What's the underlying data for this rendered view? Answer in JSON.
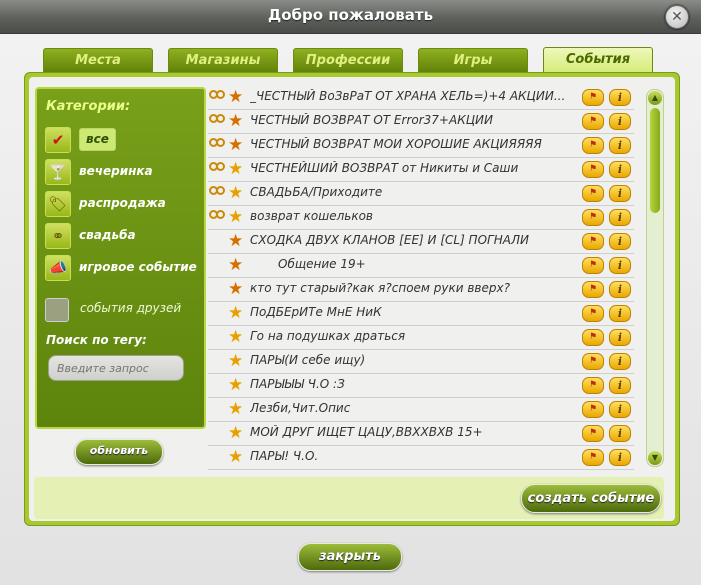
{
  "window": {
    "title": "Добро пожаловать",
    "close_glyph": "✕"
  },
  "tabs": [
    {
      "label": "Места",
      "active": false
    },
    {
      "label": "Магазины",
      "active": false
    },
    {
      "label": "Профессии",
      "active": false
    },
    {
      "label": "Игры",
      "active": false
    },
    {
      "label": "События",
      "active": true
    }
  ],
  "sidebar": {
    "heading": "Категории:",
    "categories": [
      {
        "label": "все",
        "icon": "check-icon",
        "glyph": "✔",
        "selected": true
      },
      {
        "label": "вечеринка",
        "icon": "cocktail-icon",
        "glyph": "🍸"
      },
      {
        "label": "распродажа",
        "icon": "price-tag-icon",
        "glyph": "🏷"
      },
      {
        "label": "свадьба",
        "icon": "rings-icon",
        "glyph": "⚭"
      },
      {
        "label": "игровое событие",
        "icon": "megaphone-icon",
        "glyph": "📣"
      }
    ],
    "friends_events": {
      "label": "события друзей",
      "checked": false
    },
    "tag_search": {
      "label": "Поиск по тегу:",
      "placeholder": "Введите запрос",
      "value": ""
    }
  },
  "refresh_button": "обновить",
  "events": [
    {
      "title": "_ЧЕСТНЫЙ ВоЗвРаТ ОТ ХРАНА ХЕЛЬ=)+4 АКЦИИ...",
      "rings": true,
      "dual": true
    },
    {
      "title": "ЧЕСТНЫЙ ВОЗВРАТ ОТ Error37+АКЦИИ",
      "rings": true,
      "dual": true
    },
    {
      "title": "ЧЕСТНЫЙ ВОЗВРАТ МОИ ХОРОШИЕ АКЦИЯЯЯЯ",
      "rings": true,
      "dual": true
    },
    {
      "title": "ЧЕСТНЕЙШИЙ ВОЗВРАТ от Никиты и Саши",
      "rings": true,
      "dual": false
    },
    {
      "title": "СВАДЬБА/Приходите",
      "rings": true,
      "dual": false
    },
    {
      "title": "возврат кошельков",
      "rings": true,
      "dual": false
    },
    {
      "title": "СХОДКА ДВУХ КЛАНОВ [EE] И [CL] ПОГНАЛИ",
      "rings": false,
      "dual": true
    },
    {
      "title": "Общение 19+",
      "rings": false,
      "dual": true,
      "indent": true
    },
    {
      "title": "кто тут старый?как я?споем руки вверх?",
      "rings": false,
      "dual": true
    },
    {
      "title": "ПоДБЕрИТе МнЕ НиК",
      "rings": false,
      "dual": false
    },
    {
      "title": "Го на подушках драться",
      "rings": false,
      "dual": false
    },
    {
      "title": "ПАРЫ(И себе  ищу)",
      "rings": false,
      "dual": false
    },
    {
      "title": "ПАРЫЫЫ Ч.О :З",
      "rings": false,
      "dual": false
    },
    {
      "title": "Лезби,Чит.Опис",
      "rings": false,
      "dual": false
    },
    {
      "title": "МОЙ ДРУГ ИЩЕТ ЦАЦУ,ВВХХВХВ 15+",
      "rings": false,
      "dual": false
    },
    {
      "title": "ПАРЫ! Ч.О.",
      "rings": false,
      "dual": false
    }
  ],
  "create_event_button": "создать событие",
  "close_button": "закрыть",
  "colors": {
    "accent": "#7da21e",
    "tab_active": "#d8ef86",
    "list_bg": "#f0f0ee"
  }
}
